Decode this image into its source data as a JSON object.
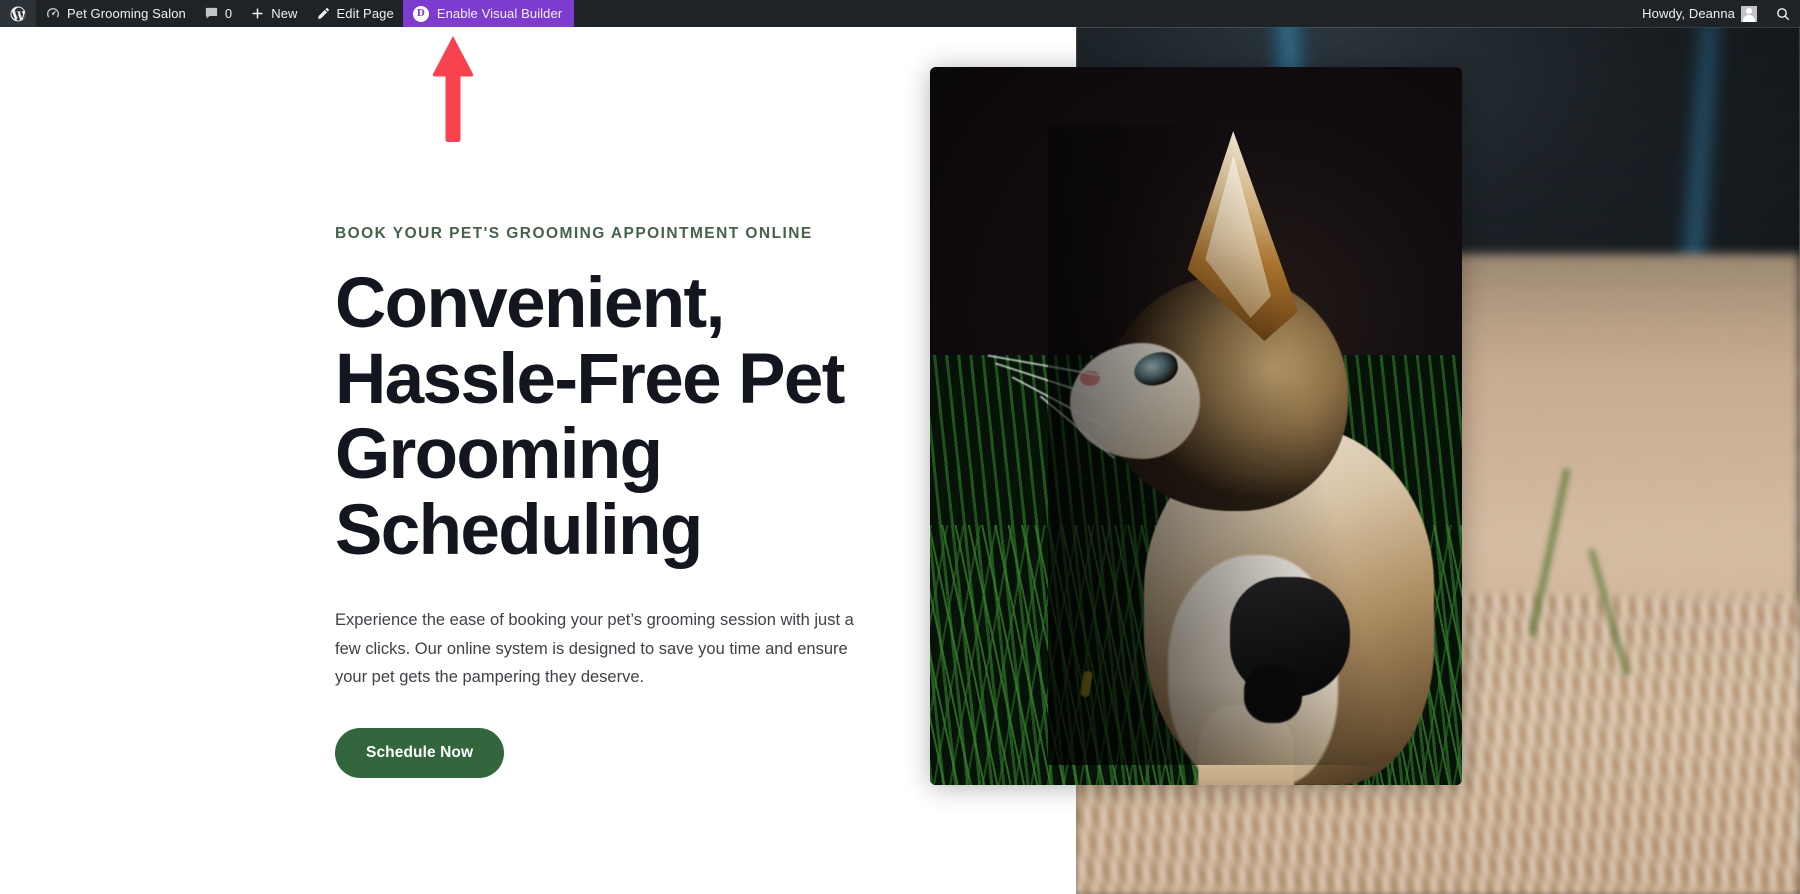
{
  "admin_bar": {
    "wp_logo_icon": "wordpress-logo-icon",
    "site_icon": "dashboard-speedometer-icon",
    "site_name": "Pet Grooming Salon",
    "comments_icon": "comment-bubble-icon",
    "comments_count": "0",
    "new_icon": "plus-icon",
    "new_label": "New",
    "edit_icon": "pencil-icon",
    "edit_label": "Edit Page",
    "divi_badge": "D",
    "visual_builder_label": "Enable Visual Builder",
    "visual_builder_color": "#7e3bd0",
    "howdy_label": "Howdy, Deanna",
    "avatar_icon": "user-avatar-icon",
    "search_icon": "search-icon",
    "bar_color": "#1d2327"
  },
  "hero": {
    "eyebrow": "BOOK YOUR PET'S GROOMING APPOINTMENT ONLINE",
    "eyebrow_color": "#46624b",
    "headline": "Convenient, Hassle-Free Pet Grooming Scheduling",
    "headline_color": "#13161f",
    "body": "Experience the ease of booking your pet’s grooming session with just a few clicks. Our online system is designed to save you time and ensure your pet gets the pampering they deserve.",
    "cta_label": "Schedule Now",
    "cta_color": "#33663d"
  },
  "media": {
    "foreground_image_alt": "Tabby cat in profile sitting in tall green grass",
    "background_image_alt": "Blurred dry grass field with blue pole"
  },
  "annotation": {
    "arrow_icon": "up-arrow-annotation-icon",
    "arrow_color": "#f8434f",
    "points_to": "Enable Visual Builder"
  }
}
